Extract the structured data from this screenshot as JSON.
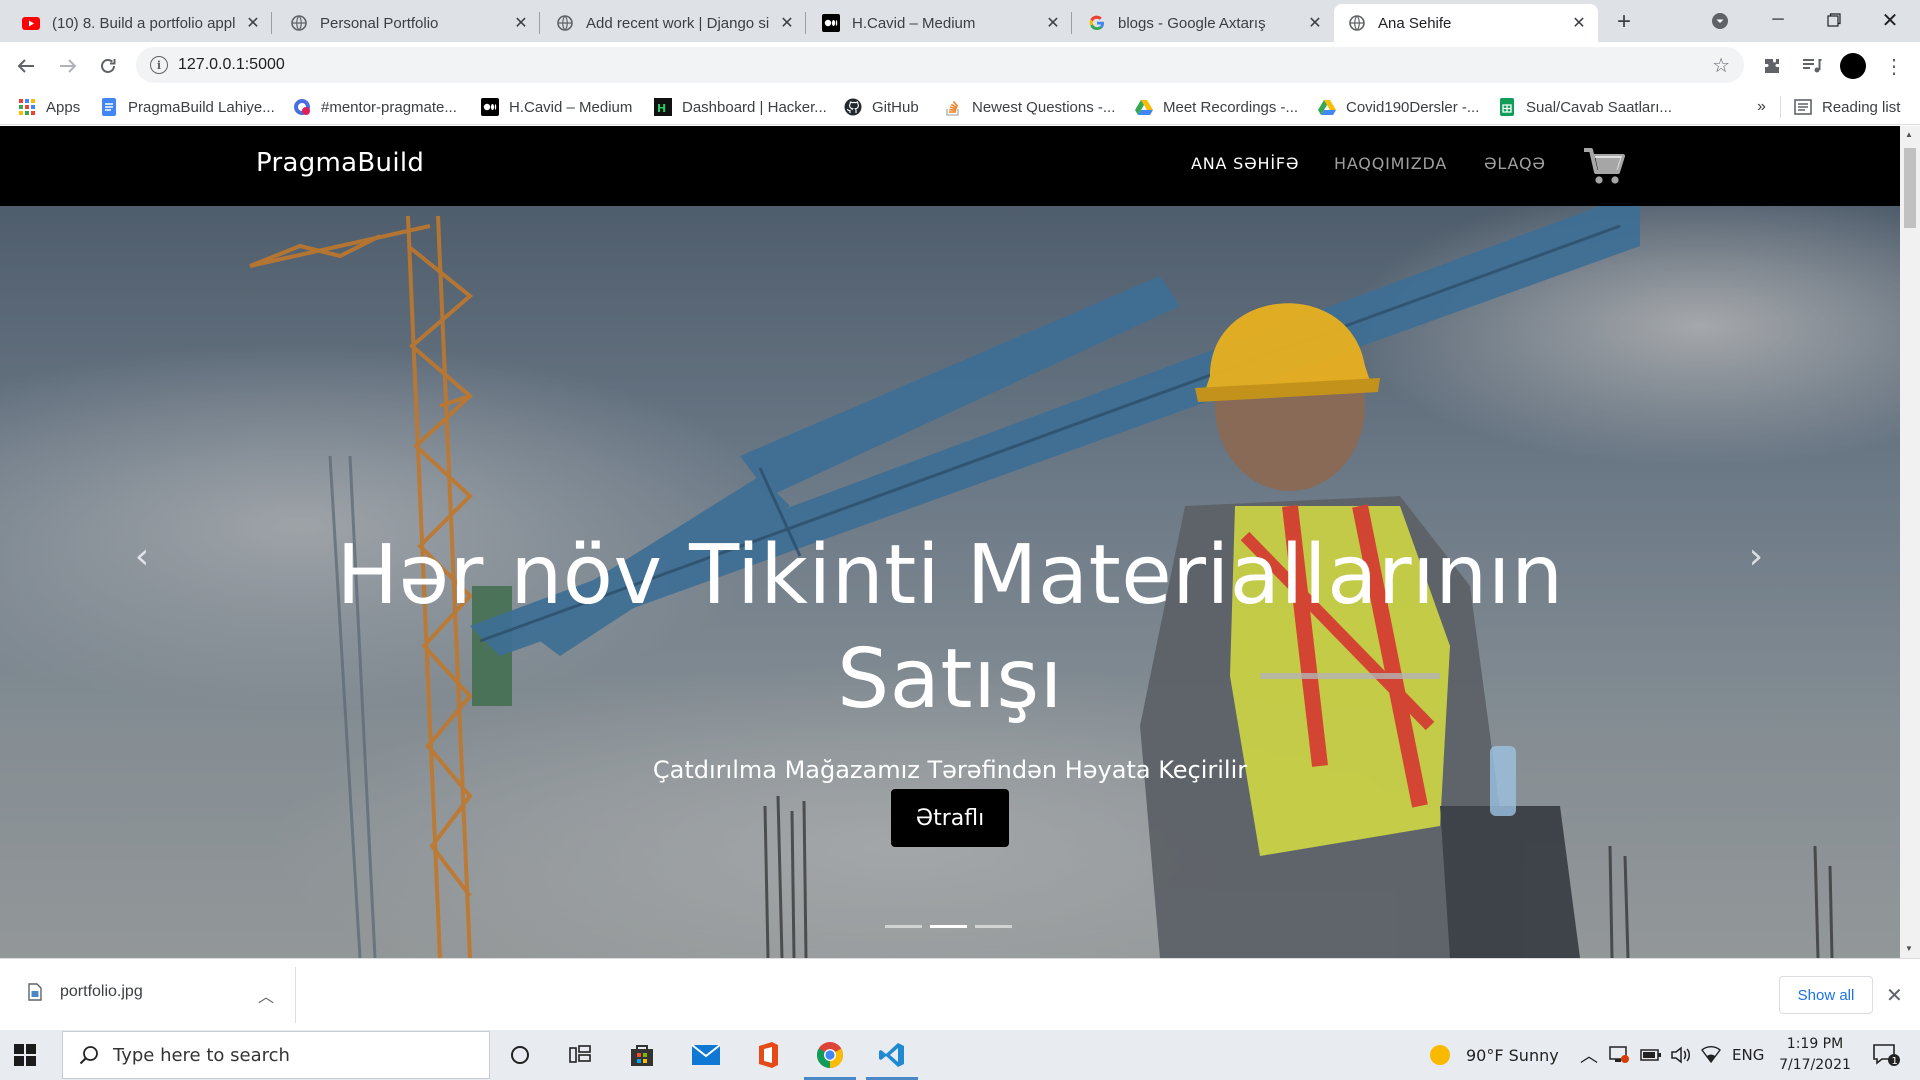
{
  "browser": {
    "tabs": [
      {
        "title": "(10) 8. Build a portfolio appl",
        "favicon": "youtube-icon",
        "active": false
      },
      {
        "title": "Personal Portfolio",
        "favicon": "globe-icon",
        "active": false
      },
      {
        "title": "Add recent work | Django si",
        "favicon": "globe-icon",
        "active": false
      },
      {
        "title": "H.Cavid – Medium",
        "favicon": "medium-icon",
        "active": false
      },
      {
        "title": "blogs - Google Axtarış",
        "favicon": "google-icon",
        "active": false
      },
      {
        "title": "Ana Sehife",
        "favicon": "globe-icon",
        "active": true
      }
    ],
    "url": "127.0.0.1:5000",
    "bookmarks": [
      {
        "label": "Apps",
        "icon": "apps-grid-icon"
      },
      {
        "label": "PragmaBuild Lahiye...",
        "icon": "docs-icon"
      },
      {
        "label": "#mentor-pragmate...",
        "icon": "slack-icon"
      },
      {
        "label": "H.Cavid – Medium",
        "icon": "medium-icon"
      },
      {
        "label": "Dashboard | Hacker...",
        "icon": "hackerrank-icon"
      },
      {
        "label": "GitHub",
        "icon": "github-icon"
      },
      {
        "label": "Newest Questions -...",
        "icon": "stackoverflow-icon"
      },
      {
        "label": "Meet Recordings -...",
        "icon": "drive-icon"
      },
      {
        "label": "Covid190Dersler -...",
        "icon": "drive-icon"
      },
      {
        "label": "Sual/Cavab Saatları...",
        "icon": "sheets-icon"
      }
    ],
    "bookmarks_overflow": "»",
    "reading_list": "Reading list"
  },
  "site": {
    "brand": "PragmaBuild",
    "nav": [
      {
        "label": "ANA SƏHİFƏ",
        "active": true
      },
      {
        "label": "HAQQIMIZDA",
        "active": false
      },
      {
        "label": "ƏLAQƏ",
        "active": false
      }
    ],
    "hero": {
      "title": "Hər növ Tikinti Materiallarının Satışı",
      "subtitle": "Çatdırılma Mağazamız Tərəfindən Həyata Keçirilir",
      "button": "Ətraflı",
      "slides_total": 3,
      "active_slide": 2,
      "prev_arrow": "‹",
      "next_arrow": "›"
    }
  },
  "downloads": {
    "file": "portfolio.jpg",
    "show_all": "Show all"
  },
  "taskbar": {
    "search_placeholder": "Type here to search",
    "weather": "90°F  Sunny",
    "language": "ENG",
    "time": "1:19 PM",
    "date": "7/17/2021",
    "notifications": "1"
  },
  "colors": {
    "tabstrip": "#dee1e6",
    "site_nav": "#000000",
    "link_blue": "#1a73e8",
    "taskbar": "#e8ecf0"
  }
}
